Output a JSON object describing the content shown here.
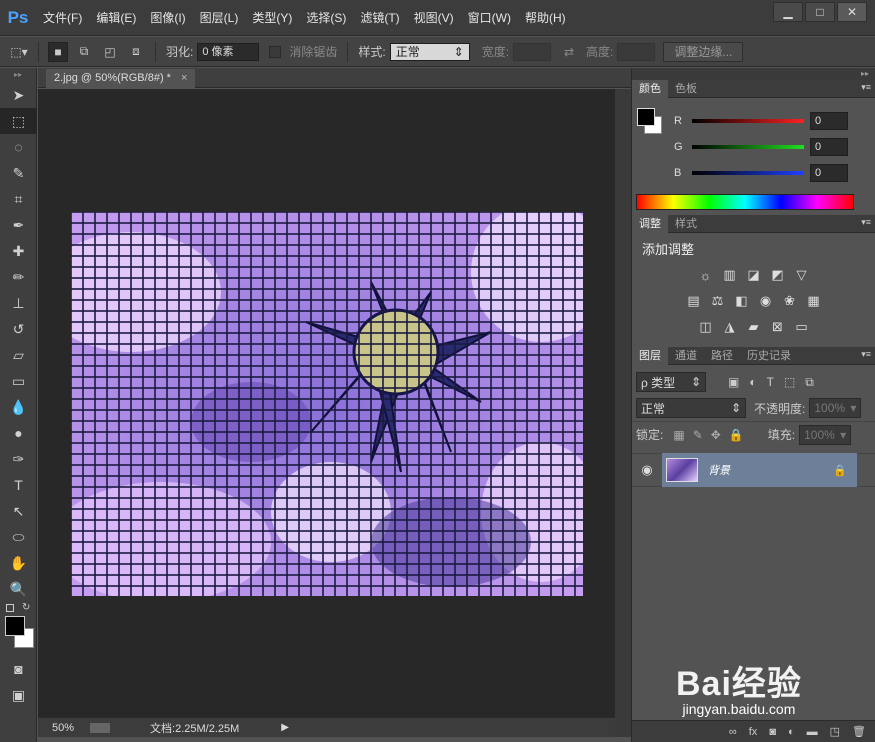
{
  "app": {
    "logo": "Ps"
  },
  "menu": [
    "文件(F)",
    "编辑(E)",
    "图像(I)",
    "图层(L)",
    "类型(Y)",
    "选择(S)",
    "滤镜(T)",
    "视图(V)",
    "窗口(W)",
    "帮助(H)"
  ],
  "window_buttons": {
    "minimize": "▁",
    "maximize": "□",
    "close": "✕"
  },
  "options": {
    "feather_label": "羽化:",
    "feather_value": "0 像素",
    "antialias_label": "消除锯齿",
    "style_label": "样式:",
    "style_value": "正常",
    "width_label": "宽度:",
    "height_label": "高度:",
    "refine_edge": "调整边缘..."
  },
  "document_tab": {
    "title": "2.jpg @ 50%(RGB/8#) *",
    "close": "×"
  },
  "status": {
    "zoom": "50%",
    "doc_info": "文档:2.25M/2.25M"
  },
  "color_panel": {
    "tabs": [
      "颜色",
      "色板"
    ],
    "channels": [
      {
        "label": "R",
        "value": "0",
        "color": "#ff2020"
      },
      {
        "label": "G",
        "value": "0",
        "color": "#20e020"
      },
      {
        "label": "B",
        "value": "0",
        "color": "#2040ff"
      }
    ]
  },
  "adjust_panel": {
    "tabs": [
      "调整",
      "样式"
    ],
    "title": "添加调整",
    "rows": [
      [
        "sun-icon",
        "levels-icon",
        "curves-icon",
        "exposure-icon",
        "triangle-icon"
      ],
      [
        "hue-icon",
        "balance-icon",
        "bw-icon",
        "photo-filter-icon",
        "channel-mixer-icon",
        "lookup-icon"
      ],
      [
        "invert-icon",
        "posterize-icon",
        "threshold-icon",
        "gradient-map-icon",
        "selective-color-icon"
      ]
    ]
  },
  "layers_panel": {
    "tabs": [
      "图层",
      "通道",
      "路径",
      "历史记录"
    ],
    "filter_label": "ρ 类型",
    "blend_mode": "正常",
    "opacity_label": "不透明度:",
    "opacity_value": "100%",
    "lock_label": "锁定:",
    "fill_label": "填充:",
    "fill_value": "100%",
    "layer_name": "背景"
  },
  "footer_icons": [
    "link-icon",
    "fx-icon",
    "mask-icon",
    "adjustment-icon",
    "folder-icon",
    "new-layer-icon",
    "trash-icon"
  ],
  "watermark": {
    "main": "Bai经验",
    "sub": "jingyan.baidu.com"
  }
}
